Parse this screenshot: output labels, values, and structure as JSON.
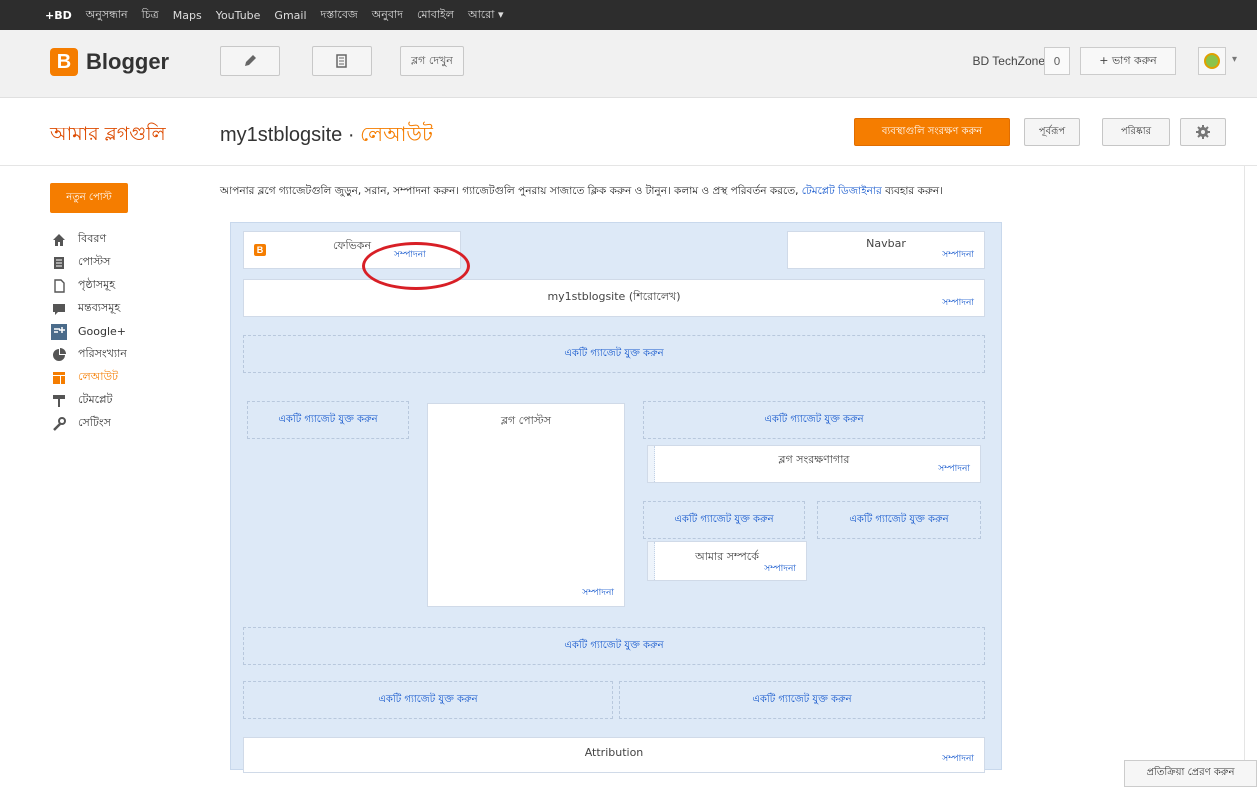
{
  "gbar": [
    "+BD",
    "অনুসন্ধান",
    "চিত্র",
    "Maps",
    "YouTube",
    "Gmail",
    "দস্তাবেজ",
    "অনুবাদ",
    "মোবাইল",
    "আরো ▾"
  ],
  "header": {
    "logo_letter": "B",
    "logo_text": "Blogger",
    "view_blog": "ব্লগ দেখুন",
    "user": "BD TechZone",
    "count": "0",
    "share": "+ ভাগ করুন",
    "dropdown": "▾"
  },
  "subheader": {
    "my_blogs": "আমার ব্লগগুলি",
    "blog_name": "my1stblogsite",
    "separator": " · ",
    "page": "লেআউট",
    "save": "ব্যবস্থাগুলি সংরক্ষণ করুন",
    "preview": "পূর্বরূপ",
    "clear": "পরিষ্কার"
  },
  "sidebar": {
    "new_post": "নতুন পোস্ট",
    "items": [
      {
        "label": "বিবরণ",
        "icon": "home-icon"
      },
      {
        "label": "পোস্টস",
        "icon": "posts-icon"
      },
      {
        "label": "পৃষ্ঠাসমূহ",
        "icon": "pages-icon"
      },
      {
        "label": "মন্তব্যসমূহ",
        "icon": "comments-icon"
      },
      {
        "label": "Google+",
        "icon": "google-plus-icon"
      },
      {
        "label": "পরিসংখ্যান",
        "icon": "stats-icon"
      },
      {
        "label": "লেআউট",
        "icon": "layout-icon",
        "active": true
      },
      {
        "label": "টেমপ্লেট",
        "icon": "template-icon"
      },
      {
        "label": "সেটিংস",
        "icon": "settings-icon"
      }
    ]
  },
  "description": {
    "text": "আপনার ব্লগে গ্যাজেটগুলি জুড়ুন, সরান, সম্পাদনা করুন। গ্যাজেটগুলি পুনরায় সাজাতে ক্লিক করুন ও টানুন। কলাম ও প্রস্থ পরিবর্তন করতে, ",
    "link": "টেমপ্লেট ডিজাইনার",
    "suffix": " ব্যবহার করুন।"
  },
  "layout": {
    "favicon": "ফেভিকন",
    "navbar": "Navbar",
    "header": "my1stblogsite (শিরোলেখ)",
    "blog_posts": "ব্লগ পোস্টস",
    "archive": "ব্লগ সংরক্ষণাগার",
    "about": "আমার সম্পর্কে",
    "attribution": "Attribution",
    "edit": "সম্পাদনা",
    "add_gadget": "একটি গ্যাজেট যুক্ত করুন"
  },
  "feedback": "প্রতিক্রিয়া প্রেরণ করুন"
}
